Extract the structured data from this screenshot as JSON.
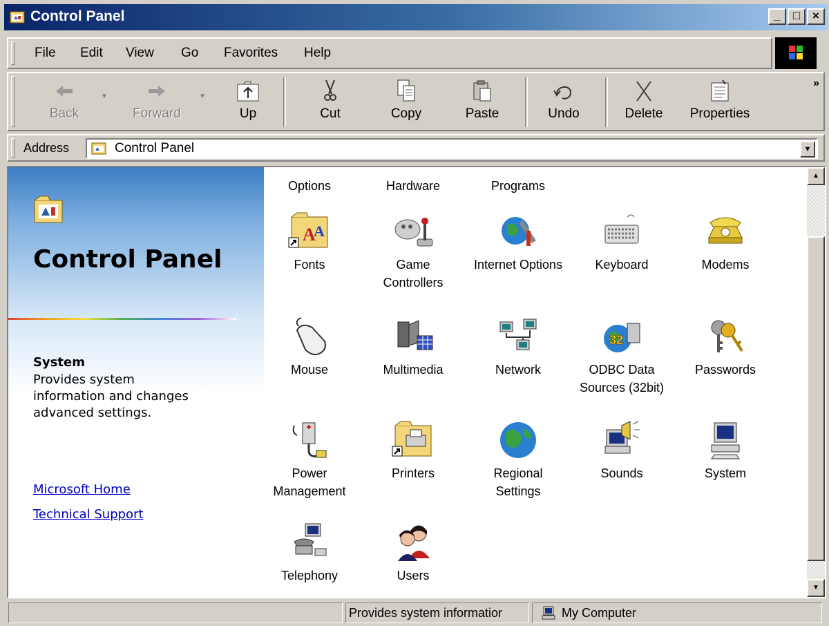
{
  "window": {
    "title": "Control Panel"
  },
  "title_buttons": {
    "minimize": "_",
    "maximize": "□",
    "close": "×"
  },
  "menu": [
    {
      "label": "File"
    },
    {
      "label": "Edit"
    },
    {
      "label": "View"
    },
    {
      "label": "Go"
    },
    {
      "label": "Favorites"
    },
    {
      "label": "Help"
    }
  ],
  "toolbar": {
    "back": "Back",
    "forward": "Forward",
    "up": "Up",
    "cut": "Cut",
    "copy": "Copy",
    "paste": "Paste",
    "undo": "Undo",
    "delete": "Delete",
    "properties": "Properties",
    "chevron": "»"
  },
  "address": {
    "label": "Address",
    "value": "Control Panel"
  },
  "left_pane": {
    "title": "Control Panel",
    "selected_title": "System",
    "selected_desc": "Provides system information and changes advanced settings.",
    "links": [
      "Microsoft Home",
      "Technical Support"
    ]
  },
  "items": [
    {
      "name": "Options",
      "icon": "accessibility-icon"
    },
    {
      "name": "Hardware",
      "icon": "add-hardware-icon"
    },
    {
      "name": "Programs",
      "icon": "add-remove-programs-icon"
    },
    {
      "name": "Fonts",
      "icon": "fonts-folder-icon"
    },
    {
      "name": "Game Controllers",
      "icon": "joystick-icon"
    },
    {
      "name": "Internet Options",
      "icon": "internet-options-icon"
    },
    {
      "name": "Keyboard",
      "icon": "keyboard-icon"
    },
    {
      "name": "Modems",
      "icon": "telephone-icon"
    },
    {
      "name": "Mouse",
      "icon": "mouse-icon"
    },
    {
      "name": "Multimedia",
      "icon": "multimedia-icon"
    },
    {
      "name": "Network",
      "icon": "network-icon"
    },
    {
      "name": "ODBC Data Sources (32bit)",
      "icon": "odbc-icon"
    },
    {
      "name": "Passwords",
      "icon": "keys-icon"
    },
    {
      "name": "Power Management",
      "icon": "power-plug-icon"
    },
    {
      "name": "Printers",
      "icon": "printers-folder-icon"
    },
    {
      "name": "Regional Settings",
      "icon": "globe-icon"
    },
    {
      "name": "Sounds",
      "icon": "speaker-icon"
    },
    {
      "name": "System",
      "icon": "computer-icon"
    },
    {
      "name": "Telephony",
      "icon": "telephony-icon"
    },
    {
      "name": "Users",
      "icon": "users-icon"
    }
  ],
  "status": {
    "message": "Provides system informatior",
    "zone": "My Computer"
  }
}
